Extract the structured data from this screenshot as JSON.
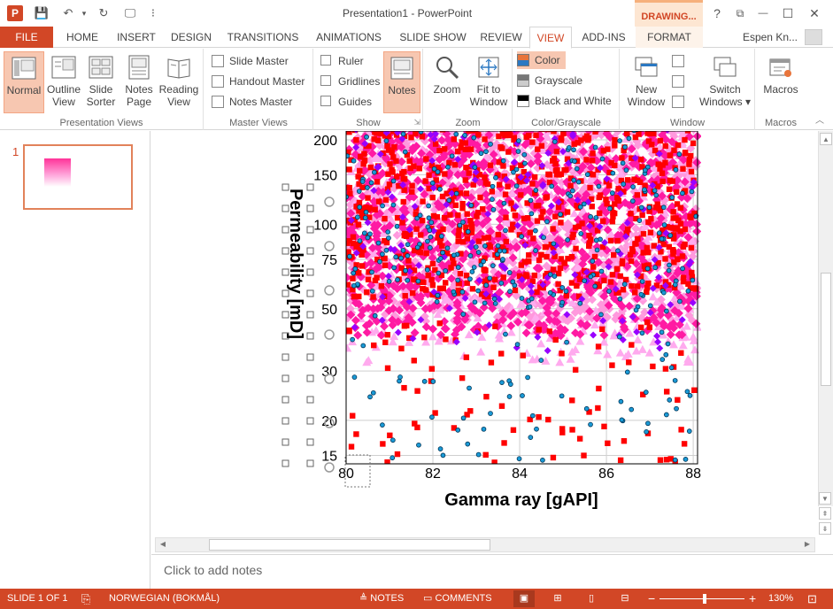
{
  "window": {
    "title": "Presentation1 - PowerPoint",
    "context_tab_header": "DRAWING...",
    "help_glyph": "?",
    "ribbon_opts_glyph": "⧉",
    "minimize_glyph": "—",
    "restore_glyph": "☐",
    "close_glyph": "✕"
  },
  "qat": {
    "app_icon_letter": "P",
    "save": "💾",
    "undo": "↶",
    "undo_drop": "▾",
    "redo": "↻",
    "present": "🖵",
    "customize": "⁝"
  },
  "tabs": [
    {
      "label": "FILE"
    },
    {
      "label": "HOME"
    },
    {
      "label": "INSERT"
    },
    {
      "label": "DESIGN"
    },
    {
      "label": "TRANSITIONS"
    },
    {
      "label": "ANIMATIONS"
    },
    {
      "label": "SLIDE SHOW"
    },
    {
      "label": "REVIEW"
    },
    {
      "label": "VIEW"
    },
    {
      "label": "ADD-INS"
    },
    {
      "label": "FORMAT"
    }
  ],
  "user": {
    "name": "Espen Kn...",
    "dropdown": "▾"
  },
  "ribbon": {
    "presentation_views": {
      "label": "Presentation Views",
      "normal": "Normal",
      "outline1": "Outline",
      "outline2": "View",
      "sorter1": "Slide",
      "sorter2": "Sorter",
      "notespage1": "Notes",
      "notespage2": "Page",
      "reading1": "Reading",
      "reading2": "View"
    },
    "master_views": {
      "label": "Master Views",
      "slide_master": "Slide Master",
      "handout_master": "Handout Master",
      "notes_master": "Notes Master"
    },
    "show": {
      "label": "Show",
      "ruler": "Ruler",
      "gridlines": "Gridlines",
      "guides": "Guides",
      "notes": "Notes",
      "launcher": "⇲"
    },
    "zoom": {
      "label": "Zoom",
      "zoom": "Zoom",
      "fit1": "Fit to",
      "fit2": "Window"
    },
    "color": {
      "label": "Color/Grayscale",
      "color": "Color",
      "grayscale": "Grayscale",
      "bw": "Black and White"
    },
    "window": {
      "label": "Window",
      "new1": "New",
      "new2": "Window",
      "switch1": "Switch",
      "switch2": "Windows ▾"
    },
    "macros": {
      "label": "Macros",
      "macros": "Macros"
    }
  },
  "thumbnails": {
    "slide_number": "1"
  },
  "notes": {
    "placeholder": "Click to add notes"
  },
  "statusbar": {
    "slide": "SLIDE 1 OF 1",
    "language": "NORWEGIAN (BOKMÅL)",
    "notes": "NOTES",
    "comments": "COMMENTS",
    "zoom_minus": "−",
    "zoom_plus": "+",
    "zoom": "130%"
  },
  "chart_data": {
    "type": "scatter",
    "xlabel": "Gamma ray [gAPI]",
    "ylabel": "Permeability [mD]",
    "x_ticks": [
      "80",
      "82",
      "84",
      "86",
      "88"
    ],
    "y_ticks": [
      "15",
      "20",
      "30",
      "50",
      "75",
      "100",
      "150",
      "200"
    ],
    "xlim": [
      80,
      88.1
    ],
    "ylim": [
      14,
      215
    ],
    "y_scale": "log",
    "grid": true,
    "series": [
      {
        "marker": "diamond",
        "color": "#ff1aa3"
      },
      {
        "marker": "diamond",
        "color": "#ff99dd"
      },
      {
        "marker": "square",
        "color": "#ff0000"
      },
      {
        "marker": "triangle",
        "color": "#ffaaee"
      },
      {
        "marker": "diamond",
        "color": "#9900ff"
      },
      {
        "marker": "circle",
        "color": "#1a9ad6"
      }
    ]
  }
}
